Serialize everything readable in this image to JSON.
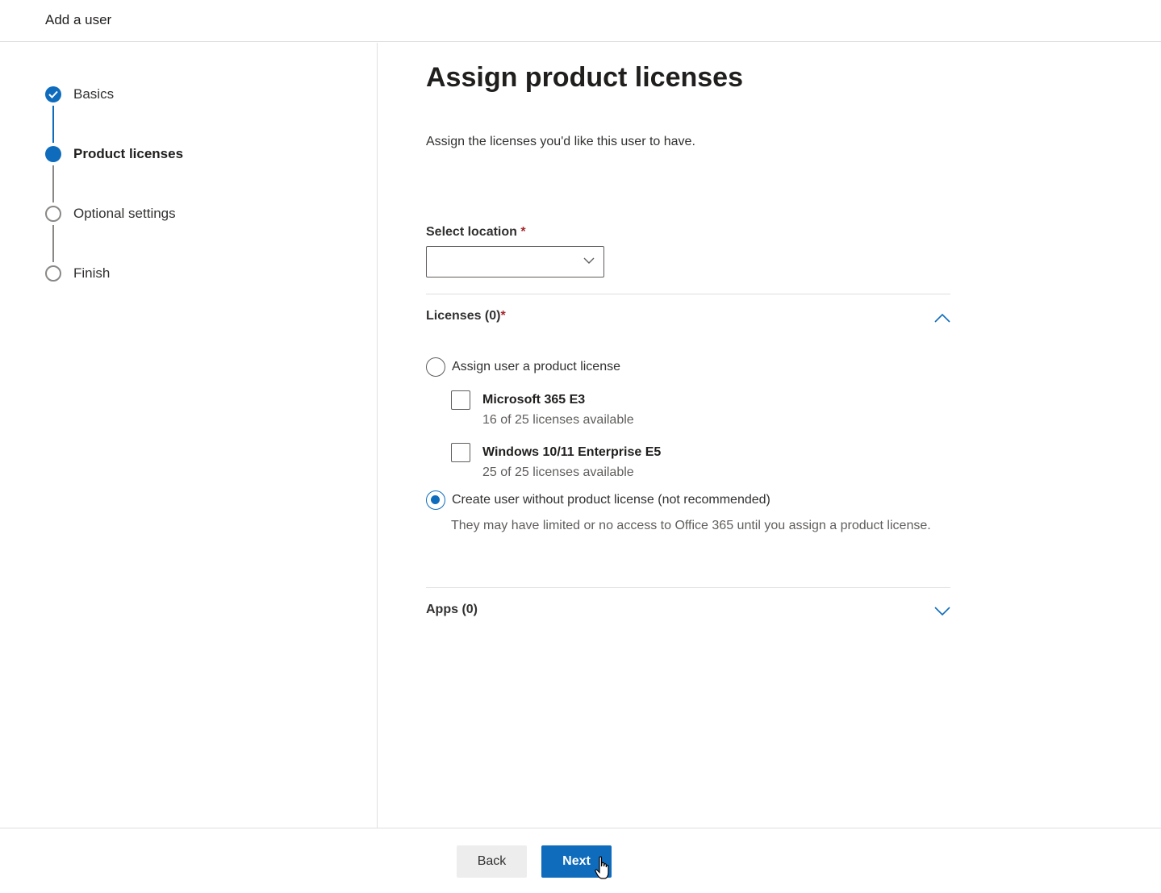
{
  "header": {
    "title": "Add a user"
  },
  "wizard": {
    "steps": [
      {
        "label": "Basics",
        "state": "done"
      },
      {
        "label": "Product licenses",
        "state": "current"
      },
      {
        "label": "Optional settings",
        "state": "pending"
      },
      {
        "label": "Finish",
        "state": "pending"
      }
    ]
  },
  "main": {
    "heading": "Assign product licenses",
    "subtitle": "Assign the licenses you'd like this user to have.",
    "location": {
      "label": "Select location",
      "required_mark": "*",
      "value": ""
    },
    "licenses_section": {
      "title": "Licenses (0)",
      "required_mark": "*",
      "expanded": true,
      "assign_option": {
        "label": "Assign user a product license",
        "selected": false
      },
      "products": [
        {
          "name": "Microsoft 365 E3",
          "availability": "16 of 25 licenses available",
          "checked": false
        },
        {
          "name": "Windows 10/11 Enterprise E5",
          "availability": "25 of 25 licenses available",
          "checked": false
        }
      ],
      "no_license_option": {
        "label": "Create user without product license (not recommended)",
        "selected": true
      },
      "note": "They may have limited or no access to Office 365 until you assign a product license."
    },
    "apps_section": {
      "title": "Apps (0)",
      "expanded": false
    }
  },
  "footer": {
    "back_label": "Back",
    "next_label": "Next"
  },
  "colors": {
    "accent": "#0f6cbd",
    "required": "#a4262c"
  }
}
